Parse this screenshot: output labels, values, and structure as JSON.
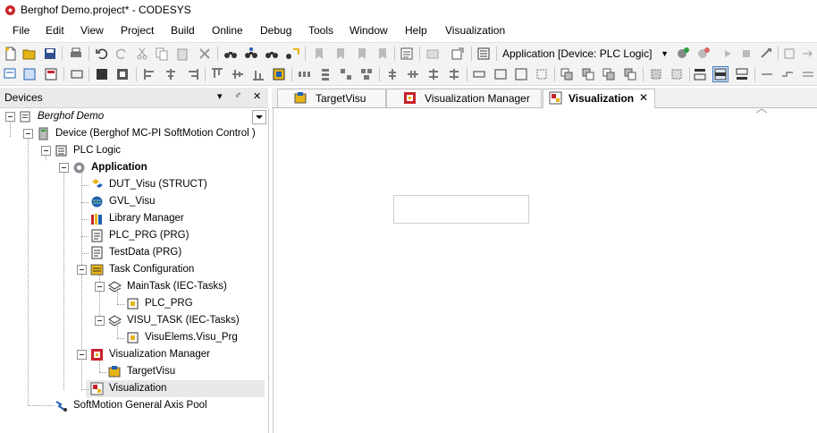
{
  "window": {
    "title": "Berghof Demo.project* - CODESYS"
  },
  "menu": [
    "File",
    "Edit",
    "View",
    "Project",
    "Build",
    "Online",
    "Debug",
    "Tools",
    "Window",
    "Help",
    "Visualization"
  ],
  "toolbar": {
    "active_application": "Application [Device: PLC Logic]"
  },
  "devices_pane": {
    "title": "Devices",
    "pin_label": "♂",
    "close_label": "✕",
    "menu_label": "▾",
    "tree": [
      {
        "label": "Berghof Demo",
        "style": "italic"
      },
      {
        "label": "Device (Berghof MC-PI SoftMotion Control )"
      },
      {
        "label": "PLC Logic"
      },
      {
        "label": "Application",
        "style": "bold"
      },
      {
        "label": "DUT_Visu (STRUCT)"
      },
      {
        "label": "GVL_Visu"
      },
      {
        "label": "Library Manager"
      },
      {
        "label": "PLC_PRG (PRG)"
      },
      {
        "label": "TestData (PRG)"
      },
      {
        "label": "Task Configuration"
      },
      {
        "label": "MainTask (IEC-Tasks)"
      },
      {
        "label": "PLC_PRG"
      },
      {
        "label": "VISU_TASK (IEC-Tasks)"
      },
      {
        "label": "VisuElems.Visu_Prg"
      },
      {
        "label": "Visualization Manager"
      },
      {
        "label": "TargetVisu"
      },
      {
        "label": "Visualization",
        "selected": true
      },
      {
        "label": "SoftMotion General Axis Pool"
      }
    ]
  },
  "editor": {
    "tabs": [
      {
        "label": "TargetVisu",
        "active": false
      },
      {
        "label": "Visualization Manager",
        "active": false
      },
      {
        "label": "Visualization",
        "active": true,
        "close": "✕"
      }
    ]
  },
  "colors": {
    "toolbar_bg": "#f3f3f3",
    "pane_header_bg": "#eaeaea",
    "selection_bg": "#e8e8e8",
    "icon_blue": "#1f5fb4",
    "icon_red": "#c8232b",
    "icon_yellow": "#e7b416"
  }
}
